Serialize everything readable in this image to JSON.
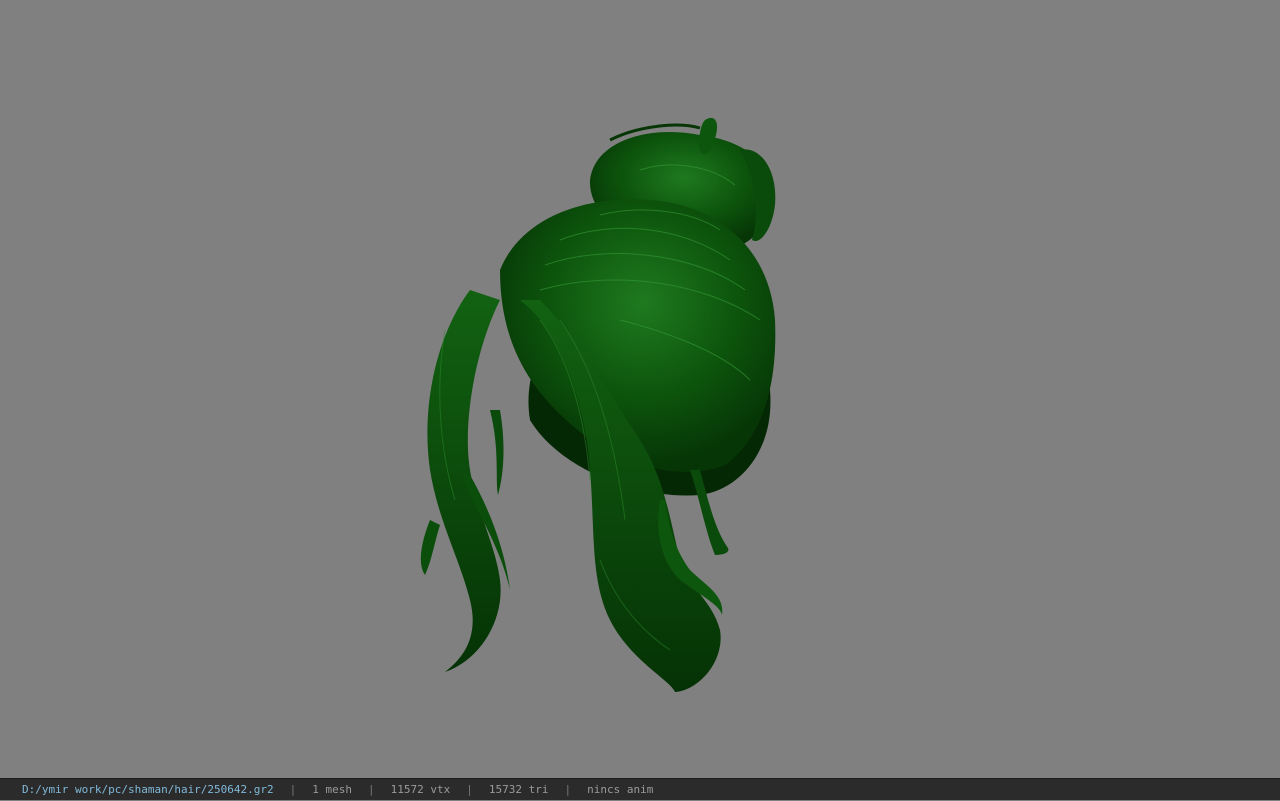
{
  "viewer": {
    "background_color": "#808080",
    "model": {
      "icon": "hair-mesh-icon",
      "color": "#0b4a0b",
      "highlight_color": "#2e8a2e"
    }
  },
  "status": {
    "file_path": "D:/ymir work/pc/shaman/hair/250642.gr2",
    "separator": "|",
    "mesh_count": "1 mesh",
    "vertex_count": "11572 vtx",
    "triangle_count": "15732 tri",
    "anim": "nincs anim"
  }
}
